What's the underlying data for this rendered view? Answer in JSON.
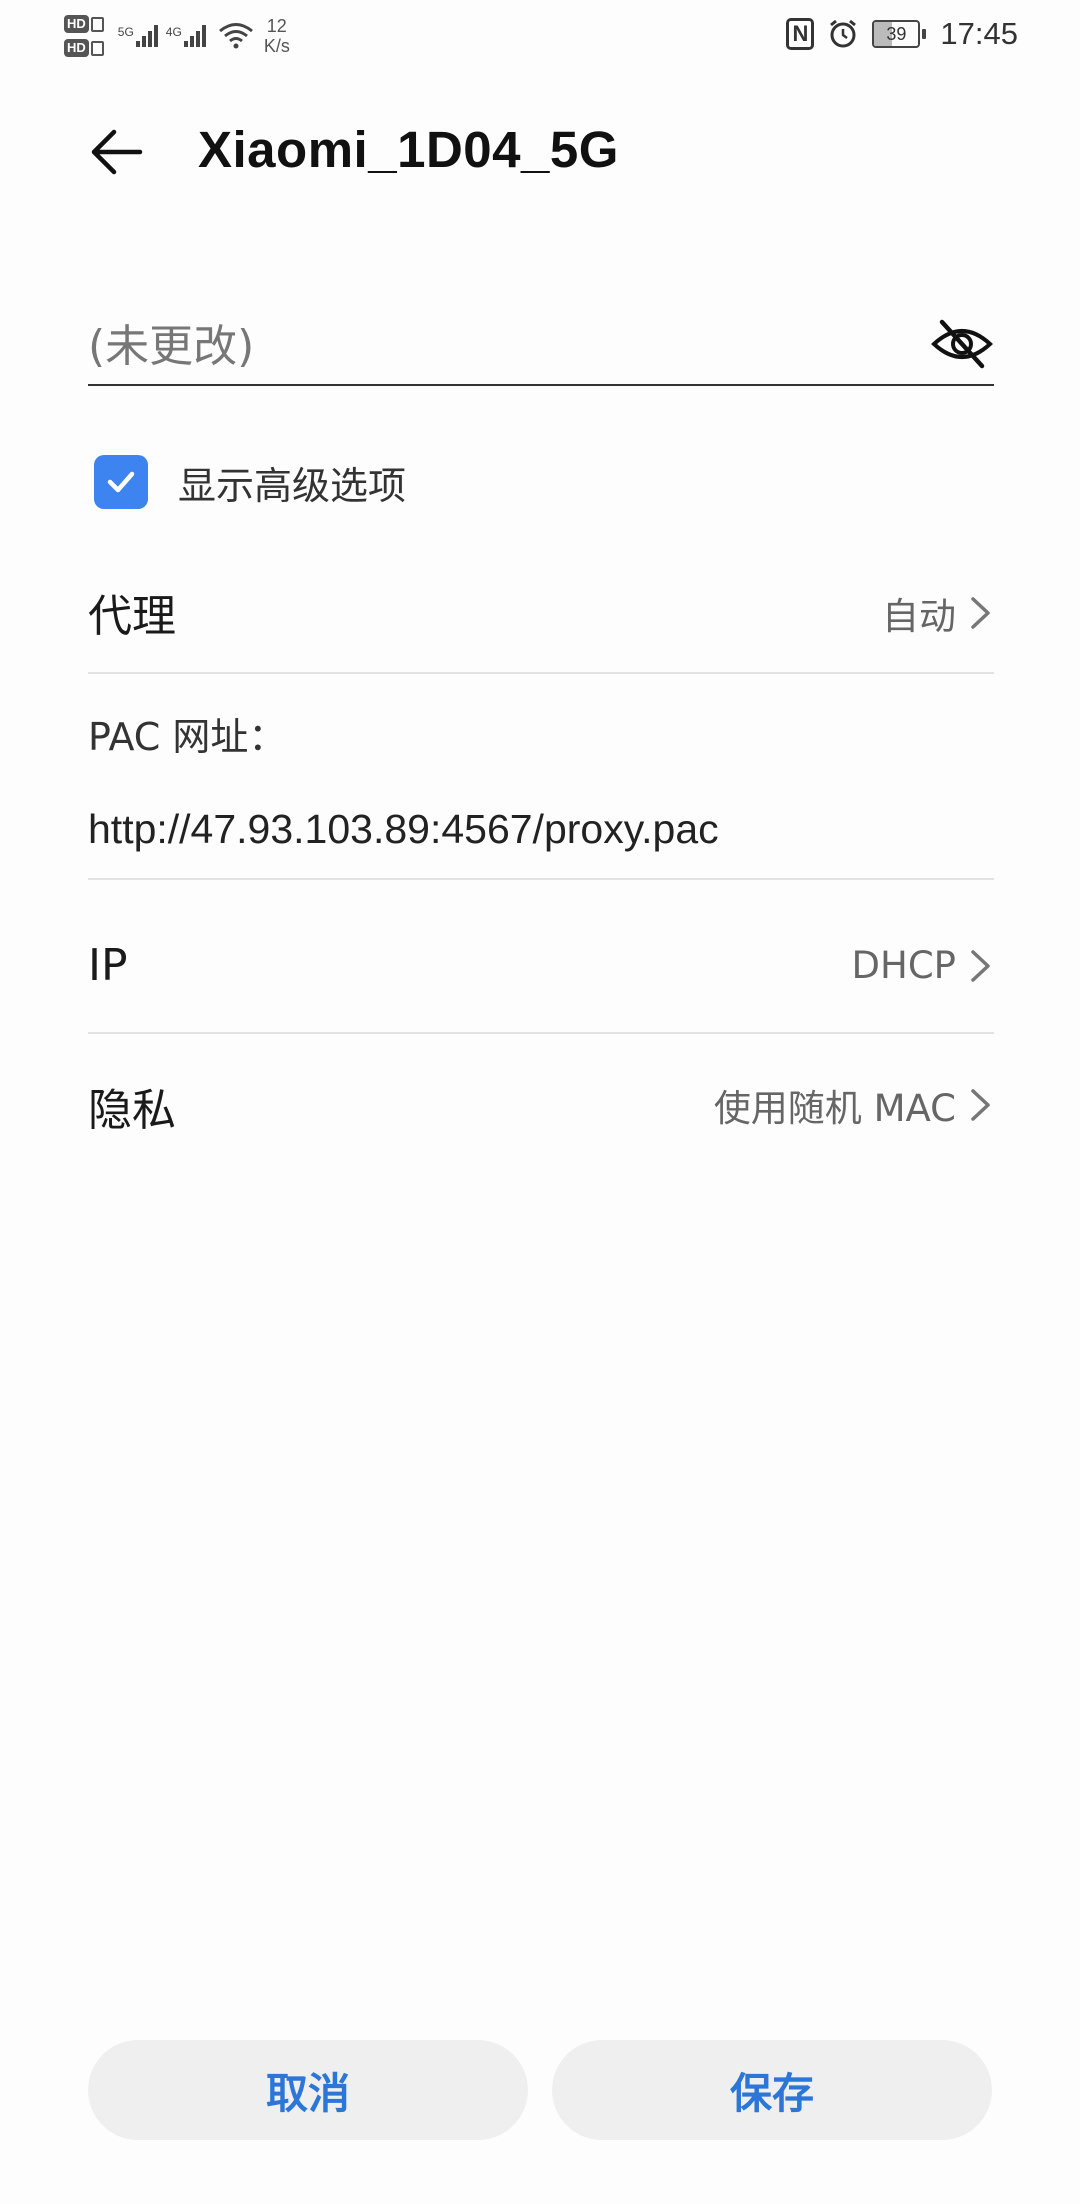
{
  "status_bar": {
    "hd_label": "HD",
    "signal1_tag": "5G",
    "signal2_tag": "4G",
    "speed_value": "12",
    "speed_unit": "K/s",
    "nfc_label": "N",
    "battery_level": "39",
    "time": "17:45",
    "icons": [
      "hd-icon",
      "signal-5g-icon",
      "signal-4g-icon",
      "wifi-icon",
      "nfc-icon",
      "alarm-icon",
      "battery-icon"
    ]
  },
  "header": {
    "title": "Xiaomi_1D04_5G",
    "back_icon": "arrow-left-icon"
  },
  "password": {
    "placeholder": "(未更改)",
    "toggle_icon": "eye-off-icon"
  },
  "advanced": {
    "label": "显示高级选项",
    "checked": true
  },
  "settings": {
    "proxy": {
      "label": "代理",
      "value": "自动"
    },
    "pac": {
      "label": "PAC 网址：",
      "value": "http://47.93.103.89:4567/proxy.pac"
    },
    "ip": {
      "label": "IP",
      "value": "DHCP"
    },
    "privacy": {
      "label": "隐私",
      "value": "使用随机 MAC"
    }
  },
  "buttons": {
    "cancel": "取消",
    "save": "保存"
  },
  "colors": {
    "accent": "#3d84f0",
    "button_text": "#2b76d8",
    "button_bg": "#efefef",
    "background": "#fdfdfd"
  }
}
